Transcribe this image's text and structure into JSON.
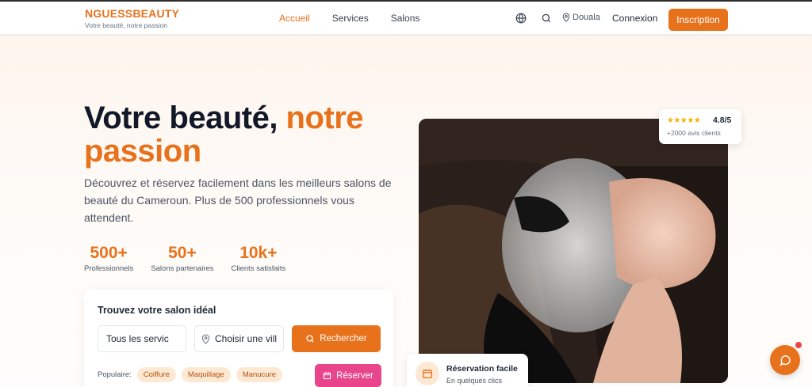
{
  "header": {
    "brand": "NGUESSBEAUTY",
    "tagline": "Votre beauté, notre passion",
    "nav": [
      "Accueil",
      "Services",
      "Salons"
    ],
    "city": "Douala",
    "login": "Connexion",
    "signup": "Inscription"
  },
  "hero": {
    "title_part1": "Votre beauté, ",
    "title_accent": "notre passion",
    "description": "Découvrez et réservez facilement dans les meilleurs salons de beauté du Cameroun. Plus de 500 professionnels vous attendent.",
    "stats": [
      {
        "value": "500+",
        "label": "Professionnels"
      },
      {
        "value": "50+",
        "label": "Salons partenaires"
      },
      {
        "value": "10k+",
        "label": "Clients satisfaits"
      }
    ]
  },
  "search": {
    "title": "Trouvez votre salon idéal",
    "service_value": "Tous les servic",
    "city_placeholder": "Choisir une vill",
    "search_button": "Rechercher",
    "popular_label": "Populaire:",
    "chips": [
      "Coiffure",
      "Maquillage",
      "Manucure"
    ],
    "reserve_button": "Réserver"
  },
  "rating": {
    "stars": "★★★★★",
    "value": "4.8/5",
    "subtitle": "+2000 avis clients"
  },
  "reservation_card": {
    "title": "Réservation facile",
    "subtitle": "En quelques clics"
  },
  "colors": {
    "accent": "#e8721c",
    "pink": "#e8458b",
    "dark": "#111827"
  }
}
